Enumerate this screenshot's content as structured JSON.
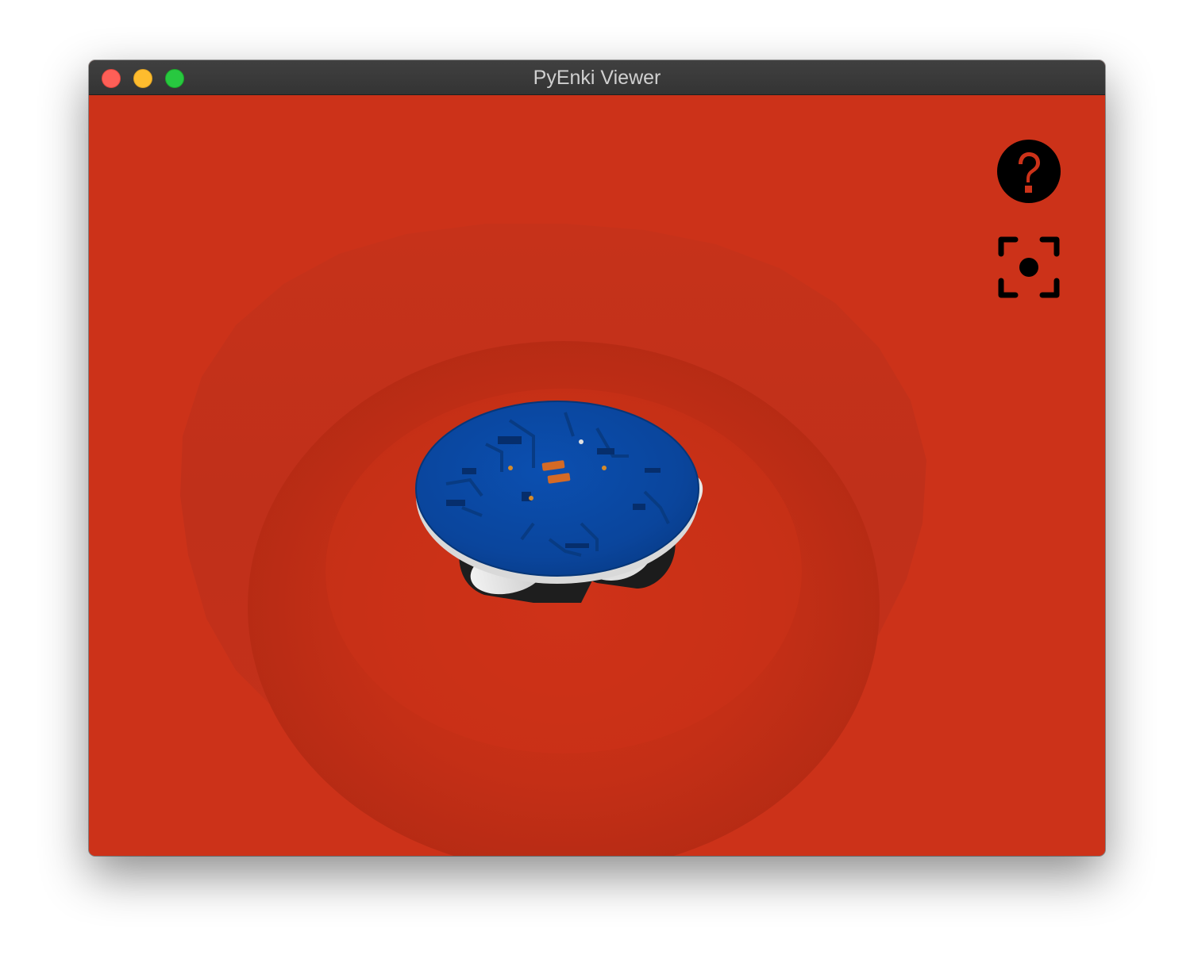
{
  "window": {
    "title": "PyEnki Viewer"
  },
  "toolbar": {
    "help_icon": "help-circle-icon",
    "camera_icon": "camera-focus-icon"
  },
  "scene": {
    "arena_color": "#cc3219",
    "robot_top_color": "#0a4aa8"
  }
}
